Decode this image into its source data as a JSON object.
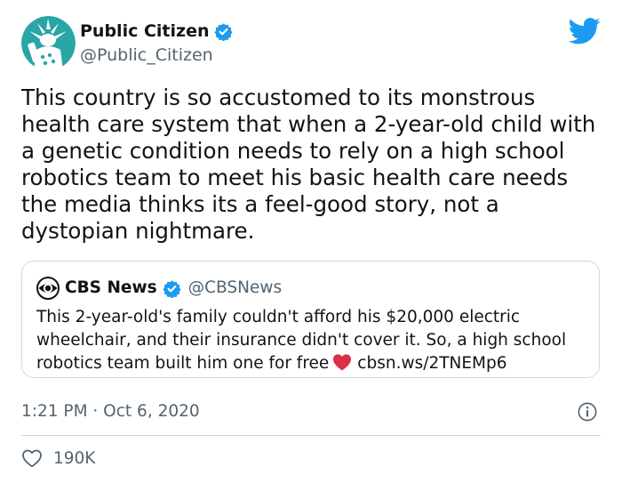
{
  "tweet": {
    "author": {
      "name": "Public Citizen",
      "handle": "@Public_Citizen",
      "verified": true,
      "avatar_icon": "statue-of-liberty-logo-icon",
      "avatar_color": "#29a5a8"
    },
    "brand_icon": "twitter-bird-icon",
    "brand_color": "#1d9bf0",
    "text": "This country is so accustomed to its monstrous health care system that when a 2-year-old child with a genetic condition needs to rely on a high school robotics team to meet his basic health care needs the media thinks its a feel-good story, not a dystopian nightmare.",
    "quote": {
      "author_name": "CBS News",
      "author_handle": "@CBSNews",
      "verified": true,
      "logo_icon": "cbs-eye-icon",
      "text_main": "This 2-year-old's family couldn't afford his $20,000 electric wheelchair, and their insurance didn't cover it. So, a high school robotics team built him one for free",
      "emoji_icon": "red-heart-icon",
      "link": "cbsn.ws/2TNEMp6"
    },
    "timestamp": "1:21 PM · Oct 6, 2020",
    "likes": "190K",
    "colors": {
      "verified_badge": "#1d9bf0",
      "heart": "#e0245e",
      "secondary_text": "#536471",
      "border": "#cfd9de"
    }
  }
}
